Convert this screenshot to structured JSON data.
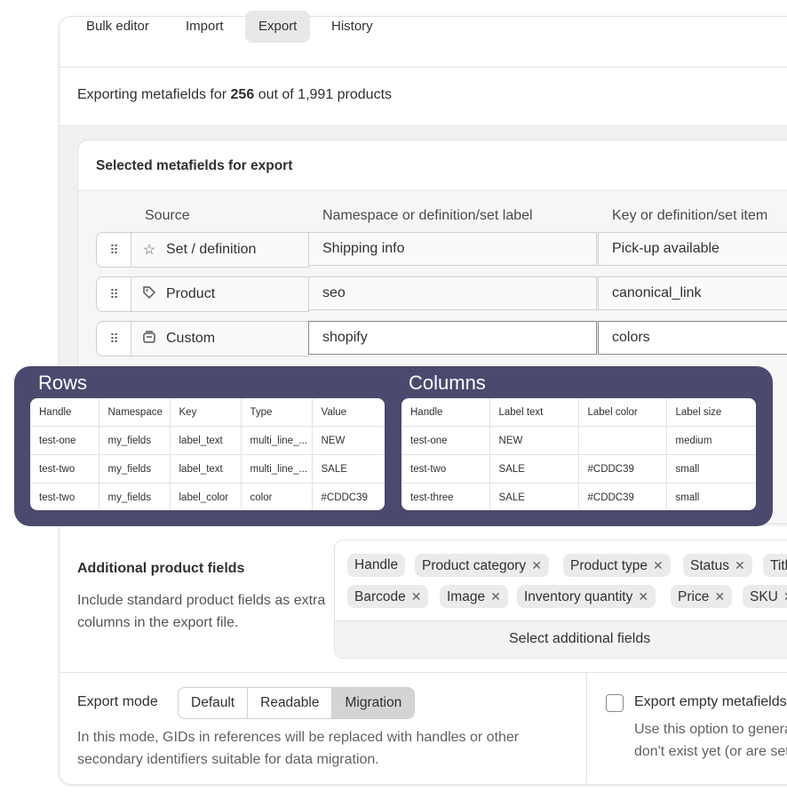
{
  "tabs": [
    {
      "label": "Bulk editor",
      "active": false
    },
    {
      "label": "Import",
      "active": false
    },
    {
      "label": "Export",
      "active": true
    },
    {
      "label": "History",
      "active": false
    }
  ],
  "summary": {
    "prefix": "Exporting metafields for",
    "count": "256",
    "suffix": "out of 1,991 products"
  },
  "selected": {
    "title": "Selected metafields for export",
    "columns": [
      "Source",
      "Namespace or definition/set label",
      "Key or definition/set item"
    ],
    "rows": [
      {
        "icon": "star-icon",
        "source": "Set / definition",
        "namespace": "Shipping info",
        "key": "Pick-up available"
      },
      {
        "icon": "tag-icon",
        "source": "Product",
        "namespace": "seo",
        "key": "canonical_link"
      },
      {
        "icon": "box-icon",
        "source": "Custom",
        "namespace": "shopify",
        "key": "colors"
      }
    ]
  },
  "overlay": {
    "rows_title": "Rows",
    "columns_title": "Columns",
    "rows_table": [
      [
        "Handle",
        "Namespace",
        "Key",
        "Type",
        "Value"
      ],
      [
        "test-one",
        "my_fields",
        "label_text",
        "multi_line_...",
        "NEW"
      ],
      [
        "test-two",
        "my_fields",
        "label_text",
        "multi_line_...",
        "SALE"
      ],
      [
        "test-two",
        "my_fields",
        "label_color",
        "color",
        "#CDDC39"
      ]
    ],
    "columns_table": [
      [
        "Handle",
        "Label text",
        "Label color",
        "Label size"
      ],
      [
        "test-one",
        "NEW",
        "",
        "medium"
      ],
      [
        "test-two",
        "SALE",
        "#CDDC39",
        "small"
      ],
      [
        "test-three",
        "SALE",
        "#CDDC39",
        "small"
      ]
    ]
  },
  "additional": {
    "title": "Additional product fields",
    "description": "Include standard product fields as extra columns in the export file.",
    "chips_row1": [
      "Handle",
      "Product category",
      "Product type",
      "Status",
      "Title"
    ],
    "chips_row2": [
      "Barcode",
      "Image",
      "Inventory quantity",
      "Price",
      "SKU"
    ],
    "select_label": "Select additional fields"
  },
  "export_mode": {
    "label": "Export mode",
    "options": [
      "Default",
      "Readable",
      "Migration"
    ],
    "selected": "Migration",
    "description": "In this mode, GIDs in references will be replaced with handles or other secondary identifiers suitable for data migration."
  },
  "empty": {
    "label": "Export empty metafields",
    "desc_line1": "Use this option to generate",
    "desc_line2": "don't exist yet (or are set",
    "checked": false
  },
  "colors": {
    "overlay_bg": "#4a4a6e",
    "active_tab": "#e8e8e8",
    "selected_segment": "#d4d4d4"
  }
}
